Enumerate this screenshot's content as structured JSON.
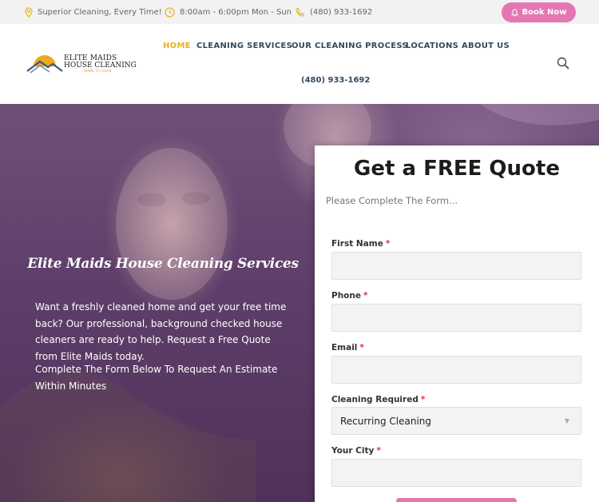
{
  "topbar": {
    "tagline": "Superior Cleaning, Every Time!",
    "hours": "8:00am - 6:00pm Mon - Sun",
    "phone": "(480) 933-1692",
    "book_label": "Book Now"
  },
  "logo": {
    "line1": "ELITE MAIDS",
    "line2": "HOUSE CLEANING",
    "tagline": "MADE TO CLEAN"
  },
  "nav": {
    "items": [
      {
        "label": "HOME",
        "active": true
      },
      {
        "label": "CLEANING SERVICES"
      },
      {
        "label": "OUR CLEANING PROCESS"
      },
      {
        "label": "LOCATIONS"
      },
      {
        "label": "ABOUT US"
      }
    ],
    "phone": "(480) 933-1692"
  },
  "hero": {
    "title": "Elite Maids House Cleaning Services",
    "paragraph1": "Want a freshly cleaned home and get your free time back? Our professional, background checked house cleaners are ready to help. Request a Free Quote from Elite Maids today.",
    "paragraph2": "Complete The Form Below To Request An Estimate Within Minutes"
  },
  "form": {
    "title": "Get a FREE Quote",
    "subtitle": "Please Complete The Form...",
    "required_mark": "*",
    "fields": [
      {
        "label": "First Name",
        "value": ""
      },
      {
        "label": "Phone",
        "value": ""
      },
      {
        "label": "Email",
        "value": ""
      },
      {
        "label": "Cleaning Required",
        "value": "Recurring Cleaning"
      },
      {
        "label": "Your City",
        "value": ""
      }
    ]
  },
  "colors": {
    "accent_pink": "#e477b3",
    "nav_active": "#e8b11c",
    "nav_text": "#334a5e",
    "required": "#e0303a"
  },
  "icons": [
    "location-pin-icon",
    "clock-icon",
    "phone-icon",
    "bell-icon",
    "search-icon",
    "chevron-down-icon"
  ]
}
